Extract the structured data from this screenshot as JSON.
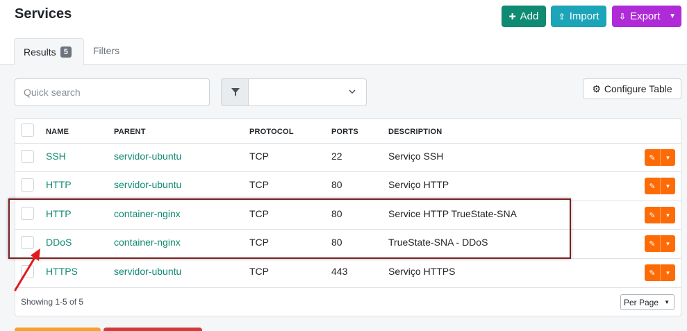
{
  "page": {
    "title": "Services"
  },
  "toolbar": {
    "add_label": "Add",
    "import_label": "Import",
    "export_label": "Export"
  },
  "tabs": {
    "results_label": "Results",
    "results_count": "5",
    "filters_label": "Filters"
  },
  "search": {
    "placeholder": "Quick search"
  },
  "configure_table_label": "Configure Table",
  "table": {
    "headers": [
      "NAME",
      "PARENT",
      "PROTOCOL",
      "PORTS",
      "DESCRIPTION"
    ],
    "rows": [
      {
        "name": "SSH",
        "parent": "servidor-ubuntu",
        "protocol": "TCP",
        "ports": "22",
        "description": "Serviço SSH"
      },
      {
        "name": "HTTP",
        "parent": "servidor-ubuntu",
        "protocol": "TCP",
        "ports": "80",
        "description": "Serviço HTTP"
      },
      {
        "name": "HTTP",
        "parent": "container-nginx",
        "protocol": "TCP",
        "ports": "80",
        "description": "Service HTTP TrueState-SNA"
      },
      {
        "name": "DDoS",
        "parent": "container-nginx",
        "protocol": "TCP",
        "ports": "80",
        "description": "TrueState-SNA - DDoS"
      },
      {
        "name": "HTTPS",
        "parent": "servidor-ubuntu",
        "protocol": "TCP",
        "ports": "443",
        "description": "Serviço HTTPS"
      }
    ]
  },
  "footer": {
    "showing": "Showing 1-5 of 5",
    "per_page_label": "Per Page"
  },
  "colors": {
    "add": "#0f8a73",
    "import": "#1ca5b8",
    "export": "#b02bd8",
    "action": "#fd6b07",
    "link": "#0f8a73",
    "annotation": "#7a1f22"
  },
  "icons": [
    "plus-icon",
    "upload-icon",
    "download-icon",
    "chevron-down-icon",
    "filter-icon",
    "gear-icon",
    "pencil-icon",
    "red-arrow-annotation"
  ]
}
